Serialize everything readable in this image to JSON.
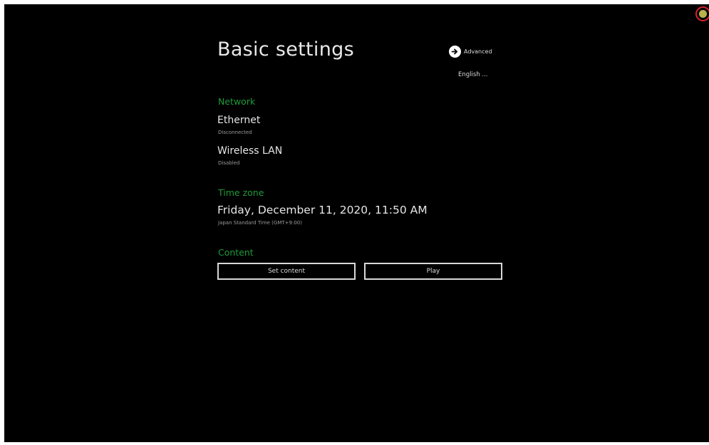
{
  "page": {
    "title": "Basic settings",
    "advanced_label": "Advanced",
    "language_label": "English ..."
  },
  "network": {
    "header": "Network",
    "ethernet": {
      "title": "Ethernet",
      "status": "Disconnected"
    },
    "wireless": {
      "title": "Wireless LAN",
      "status": "Disabled"
    }
  },
  "timezone": {
    "header": "Time zone",
    "datetime": "Friday, December 11, 2020, 11:50 AM",
    "zone": "Japan Standard Time (GMT+9:00)"
  },
  "content": {
    "header": "Content",
    "set_content_label": "Set content",
    "play_label": "Play"
  },
  "colors": {
    "background": "#000000",
    "section_header": "#1f9b3a",
    "text": "#e6e6e6",
    "indicator_ring": "#d8232a",
    "indicator_dot": "#b7b24a"
  },
  "icons": {
    "advanced": "arrow-right-circle-icon",
    "status": "status-indicator-icon"
  }
}
